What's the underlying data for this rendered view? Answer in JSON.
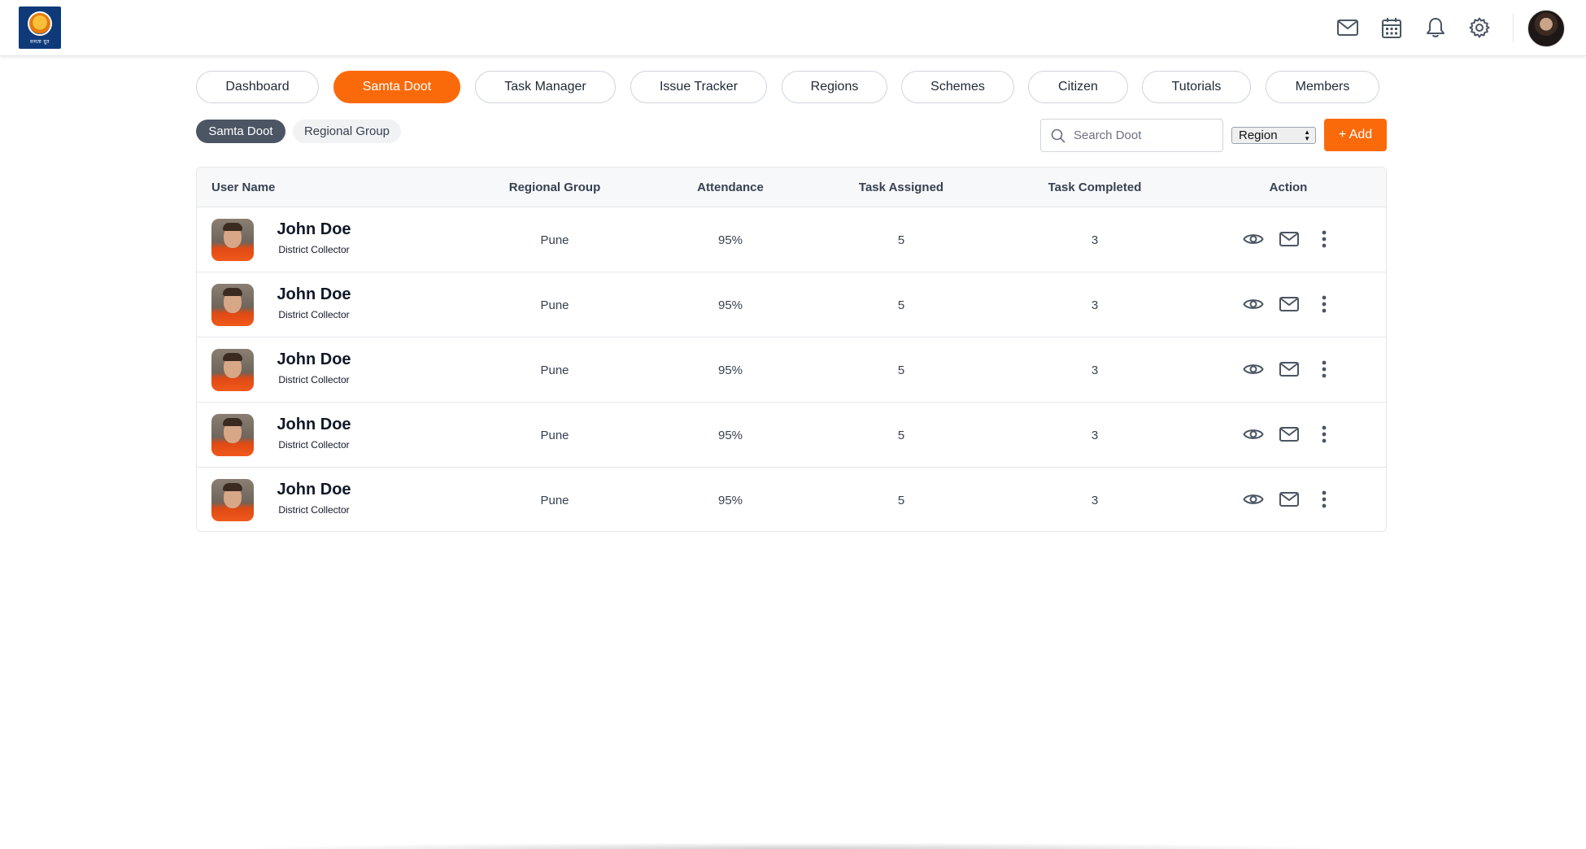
{
  "header": {
    "logo_text": "समता दूत",
    "icons": [
      "mail-icon",
      "calendar-icon",
      "bell-icon",
      "gear-icon"
    ]
  },
  "nav": {
    "tabs": [
      {
        "label": "Dashboard",
        "active": false
      },
      {
        "label": "Samta Doot",
        "active": true
      },
      {
        "label": "Task Manager",
        "active": false
      },
      {
        "label": "Issue Tracker",
        "active": false
      },
      {
        "label": "Regions",
        "active": false
      },
      {
        "label": "Schemes",
        "active": false
      },
      {
        "label": "Citizen",
        "active": false
      },
      {
        "label": "Tutorials",
        "active": false
      },
      {
        "label": "Members",
        "active": false
      }
    ]
  },
  "subtabs": [
    {
      "label": "Samta Doot",
      "active": true
    },
    {
      "label": "Regional Group",
      "active": false
    }
  ],
  "toolbar": {
    "search_placeholder": "Search Doot",
    "region_value": "Region",
    "add_label": "+ Add"
  },
  "table": {
    "columns": [
      "User Name",
      "Regional Group",
      "Attendance",
      "Task Assigned",
      "Task Completed",
      "Action"
    ],
    "rows": [
      {
        "name": "John Doe",
        "role": "District Collector",
        "group": "Pune",
        "attendance": "95%",
        "assigned": "5",
        "completed": "3"
      },
      {
        "name": "John Doe",
        "role": "District Collector",
        "group": "Pune",
        "attendance": "95%",
        "assigned": "5",
        "completed": "3"
      },
      {
        "name": "John Doe",
        "role": "District Collector",
        "group": "Pune",
        "attendance": "95%",
        "assigned": "5",
        "completed": "3"
      },
      {
        "name": "John Doe",
        "role": "District Collector",
        "group": "Pune",
        "attendance": "95%",
        "assigned": "5",
        "completed": "3"
      },
      {
        "name": "John Doe",
        "role": "District Collector",
        "group": "Pune",
        "attendance": "95%",
        "assigned": "5",
        "completed": "3"
      }
    ]
  },
  "colors": {
    "accent": "#fb6a0a",
    "subtab_active": "#4b5563"
  }
}
